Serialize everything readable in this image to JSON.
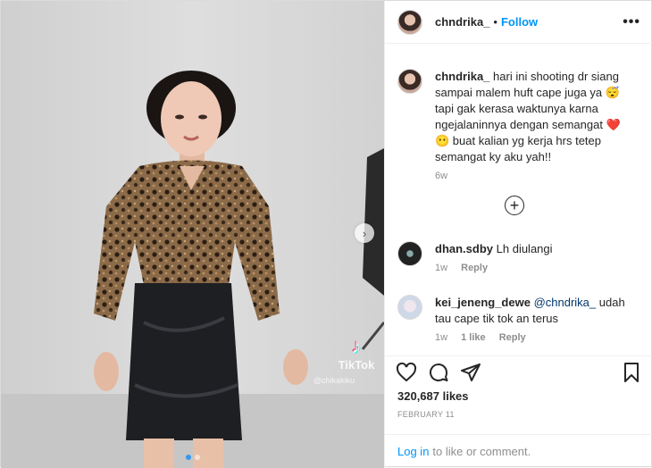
{
  "header": {
    "username": "chndrika_",
    "separator": "•",
    "follow_label": "Follow",
    "more_label": "•••"
  },
  "caption": {
    "username": "chndrika_",
    "text": "hari ini shooting dr siang sampai malem huft cape juga ya 😴 tapi gak kerasa waktunya karna ngejalaninnya dengan semangat ❤️ 😶 buat kalian yg kerja hrs tetep semangat ky aku yah!!",
    "time": "6w"
  },
  "load_more_label": "+",
  "comments": [
    {
      "username": "dhan.sdby",
      "text": "Lh diulangi",
      "time": "1w",
      "likes": "",
      "reply_label": "Reply"
    },
    {
      "username": "kei_jeneng_dewe",
      "mention": "@chndrika_",
      "text": "udah tau cape tik tok an terus",
      "time": "1w",
      "likes": "1 like",
      "reply_label": "Reply"
    }
  ],
  "media": {
    "watermark_brand": "TikTok",
    "watermark_handle": "@chikakiku",
    "next_label": "›",
    "slide_count": 2,
    "active_slide": 1
  },
  "actions": {
    "like_icon": "heart-icon",
    "comment_icon": "comment-icon",
    "share_icon": "paper-plane-icon",
    "save_icon": "bookmark-icon",
    "likes": "320,687 likes",
    "date": "FEBRUARY 11"
  },
  "footer": {
    "login_link": "Log in",
    "login_text": "to like or comment."
  },
  "colors": {
    "accent": "#0095f6",
    "muted": "#8e8e8e",
    "text": "#262626"
  }
}
